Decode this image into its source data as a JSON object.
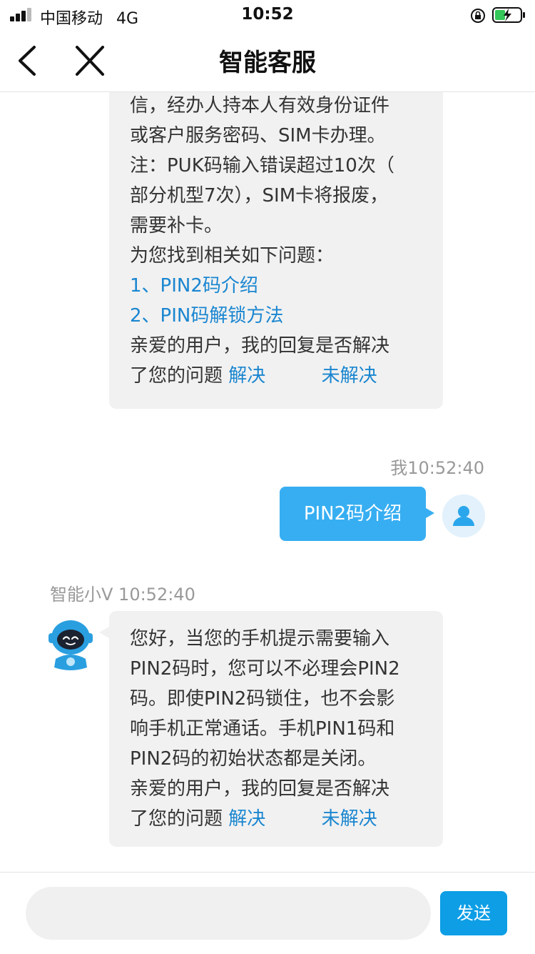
{
  "status_bar": {
    "carrier": "中国移动",
    "network": "4G",
    "time": "10:52"
  },
  "nav": {
    "title": "智能客服"
  },
  "messages": [
    {
      "sender": "bot",
      "lines": [
        "信，经办人持本人有效身份证件",
        "或客户服务密码、SIM卡办理。",
        "注：PUK码输入错误超过10次（",
        "部分机型7次），SIM卡将报废，",
        "需要补卡。",
        "为您找到相关如下问题："
      ],
      "links": [
        "1、PIN2码介绍",
        "2、PIN码解锁方法"
      ],
      "feedback": {
        "line1": "亲爱的用户，我的回复是否解决",
        "line2": "了您的问题",
        "resolved": "解决",
        "unresolved": "未解决"
      }
    },
    {
      "sender": "user",
      "time": "我10:52:40",
      "text": "PIN2码介绍"
    },
    {
      "sender": "bot",
      "time": "智能小V 10:52:40",
      "lines": [
        "您好，当您的手机提示需要输入",
        "PIN2码时，您可以不必理会PIN2",
        "码。即使PIN2码锁住，也不会影",
        "响手机正常通话。手机PIN1码和",
        "PIN2码的初始状态都是关闭。"
      ],
      "feedback": {
        "line1": "亲爱的用户，我的回复是否解决",
        "line2": "了您的问题",
        "resolved": "解决",
        "unresolved": "未解决"
      }
    }
  ],
  "input": {
    "placeholder": "",
    "send_label": "发送"
  },
  "colors": {
    "link": "#1a86d0",
    "user_bubble": "#37aef2",
    "send_button": "#0d9ee6",
    "bot_bubble": "#f1f1f1"
  }
}
